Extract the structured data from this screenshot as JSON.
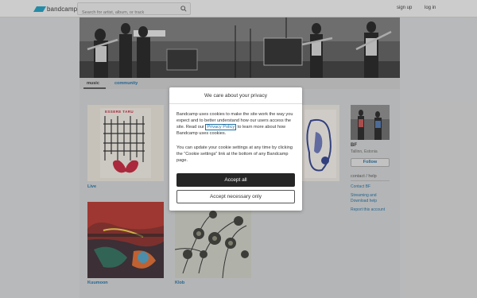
{
  "topbar": {
    "logo_text": "bandcamp",
    "search_placeholder": "Search for artist, album, or track",
    "sign_up": "sign up",
    "log_in": "log in"
  },
  "nav": {
    "music": "music",
    "community": "community"
  },
  "albums": [
    {
      "title": "Live",
      "art_text": "ESSERE TARU"
    },
    {
      "title": ""
    },
    {
      "title": ""
    },
    {
      "title": "Kuumoon"
    },
    {
      "title": "Klob"
    }
  ],
  "sidebar": {
    "artist_name": "BF",
    "location": "Tallinn, Estonia",
    "follow_label": "Follow",
    "contact_heading": "contact / help",
    "links": [
      "Contact BF",
      "Streaming and Download help",
      "Report this account"
    ]
  },
  "cookie_modal": {
    "title": "We care about your privacy",
    "para1_before": "Bandcamp uses cookies to make the site work the way you expect and to better understand how our users access the site. Read our ",
    "policy_link": "Privacy Policy",
    "para1_after": " to learn more about how Bandcamp uses cookies.",
    "para2": "You can update your cookie settings at any time by clicking the “Cookie settings” link at the bottom of any Bandcamp page.",
    "accept_all": "Accept all",
    "accept_necessary": "Accept necessary only"
  },
  "colors": {
    "brand": "#1da0c3",
    "link": "#1d6fa5",
    "accept_button": "#262626"
  }
}
